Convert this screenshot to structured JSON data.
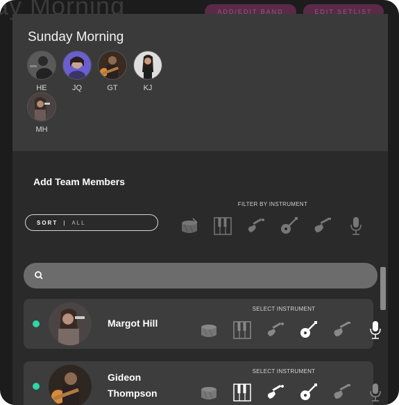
{
  "background": {
    "title": "ay Morning",
    "buttons": [
      "ADD/EDIT BAND",
      "EDIT SETLIST"
    ]
  },
  "band": {
    "name": "Sunday Morning",
    "members": [
      {
        "initials": "HE"
      },
      {
        "initials": "JQ"
      },
      {
        "initials": "GT"
      },
      {
        "initials": "KJ"
      },
      {
        "initials": "MH"
      }
    ]
  },
  "add_section": {
    "title": "Add Team Members",
    "filter_label": "FILTER BY INSTRUMENT",
    "sort": {
      "label": "SORT",
      "value": "ALL"
    },
    "instruments": [
      "drum-icon",
      "keyboard-icon",
      "electric-guitar-icon",
      "acoustic-guitar-icon",
      "bass-guitar-icon",
      "microphone-icon"
    ]
  },
  "search": {
    "placeholder": ""
  },
  "cards": [
    {
      "name_line1": "Margot Hill",
      "name_line2": "",
      "select_label": "SELECT INSTRUMENT",
      "online": true,
      "active_instruments": [
        "acoustic-guitar-icon",
        "microphone-icon"
      ]
    },
    {
      "name_line1": "Gideon",
      "name_line2": "Thompson",
      "select_label": "SELECT INSTRUMENT",
      "online": true,
      "active_instruments": [
        "keyboard-icon",
        "electric-guitar-icon",
        "acoustic-guitar-icon"
      ]
    }
  ],
  "colors": {
    "online": "#2fd6a6",
    "active_icon": "#ffffff",
    "inactive_icon": "#8a8a8a"
  }
}
